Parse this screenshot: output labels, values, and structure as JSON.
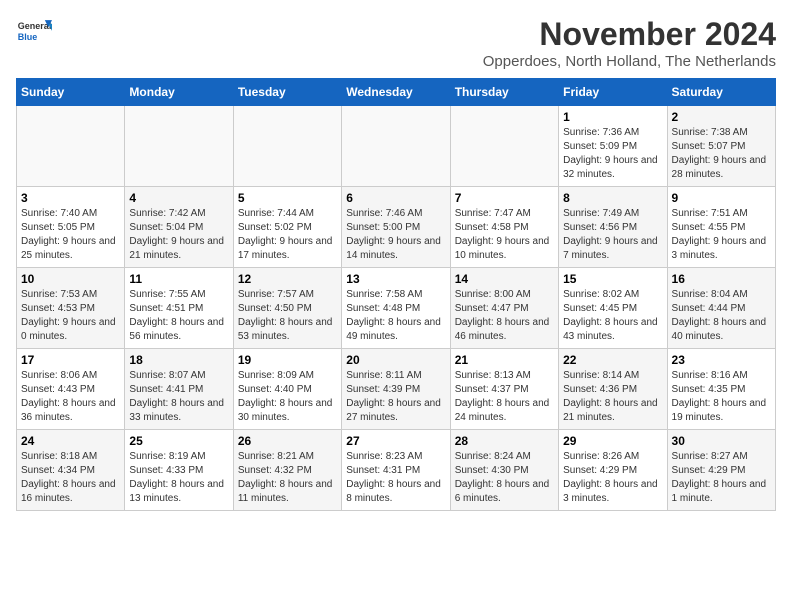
{
  "logo": {
    "general": "General",
    "blue": "Blue"
  },
  "header": {
    "month_title": "November 2024",
    "subtitle": "Opperdoes, North Holland, The Netherlands"
  },
  "weekdays": [
    "Sunday",
    "Monday",
    "Tuesday",
    "Wednesday",
    "Thursday",
    "Friday",
    "Saturday"
  ],
  "weeks": [
    [
      {
        "day": "",
        "info": "",
        "empty": true
      },
      {
        "day": "",
        "info": "",
        "empty": true
      },
      {
        "day": "",
        "info": "",
        "empty": true
      },
      {
        "day": "",
        "info": "",
        "empty": true
      },
      {
        "day": "",
        "info": "",
        "empty": true
      },
      {
        "day": "1",
        "info": "Sunrise: 7:36 AM\nSunset: 5:09 PM\nDaylight: 9 hours and 32 minutes.",
        "empty": false,
        "shaded": false
      },
      {
        "day": "2",
        "info": "Sunrise: 7:38 AM\nSunset: 5:07 PM\nDaylight: 9 hours and 28 minutes.",
        "empty": false,
        "shaded": true
      }
    ],
    [
      {
        "day": "3",
        "info": "Sunrise: 7:40 AM\nSunset: 5:05 PM\nDaylight: 9 hours and 25 minutes.",
        "empty": false,
        "shaded": false
      },
      {
        "day": "4",
        "info": "Sunrise: 7:42 AM\nSunset: 5:04 PM\nDaylight: 9 hours and 21 minutes.",
        "empty": false,
        "shaded": true
      },
      {
        "day": "5",
        "info": "Sunrise: 7:44 AM\nSunset: 5:02 PM\nDaylight: 9 hours and 17 minutes.",
        "empty": false,
        "shaded": false
      },
      {
        "day": "6",
        "info": "Sunrise: 7:46 AM\nSunset: 5:00 PM\nDaylight: 9 hours and 14 minutes.",
        "empty": false,
        "shaded": true
      },
      {
        "day": "7",
        "info": "Sunrise: 7:47 AM\nSunset: 4:58 PM\nDaylight: 9 hours and 10 minutes.",
        "empty": false,
        "shaded": false
      },
      {
        "day": "8",
        "info": "Sunrise: 7:49 AM\nSunset: 4:56 PM\nDaylight: 9 hours and 7 minutes.",
        "empty": false,
        "shaded": true
      },
      {
        "day": "9",
        "info": "Sunrise: 7:51 AM\nSunset: 4:55 PM\nDaylight: 9 hours and 3 minutes.",
        "empty": false,
        "shaded": false
      }
    ],
    [
      {
        "day": "10",
        "info": "Sunrise: 7:53 AM\nSunset: 4:53 PM\nDaylight: 9 hours and 0 minutes.",
        "empty": false,
        "shaded": true
      },
      {
        "day": "11",
        "info": "Sunrise: 7:55 AM\nSunset: 4:51 PM\nDaylight: 8 hours and 56 minutes.",
        "empty": false,
        "shaded": false
      },
      {
        "day": "12",
        "info": "Sunrise: 7:57 AM\nSunset: 4:50 PM\nDaylight: 8 hours and 53 minutes.",
        "empty": false,
        "shaded": true
      },
      {
        "day": "13",
        "info": "Sunrise: 7:58 AM\nSunset: 4:48 PM\nDaylight: 8 hours and 49 minutes.",
        "empty": false,
        "shaded": false
      },
      {
        "day": "14",
        "info": "Sunrise: 8:00 AM\nSunset: 4:47 PM\nDaylight: 8 hours and 46 minutes.",
        "empty": false,
        "shaded": true
      },
      {
        "day": "15",
        "info": "Sunrise: 8:02 AM\nSunset: 4:45 PM\nDaylight: 8 hours and 43 minutes.",
        "empty": false,
        "shaded": false
      },
      {
        "day": "16",
        "info": "Sunrise: 8:04 AM\nSunset: 4:44 PM\nDaylight: 8 hours and 40 minutes.",
        "empty": false,
        "shaded": true
      }
    ],
    [
      {
        "day": "17",
        "info": "Sunrise: 8:06 AM\nSunset: 4:43 PM\nDaylight: 8 hours and 36 minutes.",
        "empty": false,
        "shaded": false
      },
      {
        "day": "18",
        "info": "Sunrise: 8:07 AM\nSunset: 4:41 PM\nDaylight: 8 hours and 33 minutes.",
        "empty": false,
        "shaded": true
      },
      {
        "day": "19",
        "info": "Sunrise: 8:09 AM\nSunset: 4:40 PM\nDaylight: 8 hours and 30 minutes.",
        "empty": false,
        "shaded": false
      },
      {
        "day": "20",
        "info": "Sunrise: 8:11 AM\nSunset: 4:39 PM\nDaylight: 8 hours and 27 minutes.",
        "empty": false,
        "shaded": true
      },
      {
        "day": "21",
        "info": "Sunrise: 8:13 AM\nSunset: 4:37 PM\nDaylight: 8 hours and 24 minutes.",
        "empty": false,
        "shaded": false
      },
      {
        "day": "22",
        "info": "Sunrise: 8:14 AM\nSunset: 4:36 PM\nDaylight: 8 hours and 21 minutes.",
        "empty": false,
        "shaded": true
      },
      {
        "day": "23",
        "info": "Sunrise: 8:16 AM\nSunset: 4:35 PM\nDaylight: 8 hours and 19 minutes.",
        "empty": false,
        "shaded": false
      }
    ],
    [
      {
        "day": "24",
        "info": "Sunrise: 8:18 AM\nSunset: 4:34 PM\nDaylight: 8 hours and 16 minutes.",
        "empty": false,
        "shaded": true
      },
      {
        "day": "25",
        "info": "Sunrise: 8:19 AM\nSunset: 4:33 PM\nDaylight: 8 hours and 13 minutes.",
        "empty": false,
        "shaded": false
      },
      {
        "day": "26",
        "info": "Sunrise: 8:21 AM\nSunset: 4:32 PM\nDaylight: 8 hours and 11 minutes.",
        "empty": false,
        "shaded": true
      },
      {
        "day": "27",
        "info": "Sunrise: 8:23 AM\nSunset: 4:31 PM\nDaylight: 8 hours and 8 minutes.",
        "empty": false,
        "shaded": false
      },
      {
        "day": "28",
        "info": "Sunrise: 8:24 AM\nSunset: 4:30 PM\nDaylight: 8 hours and 6 minutes.",
        "empty": false,
        "shaded": true
      },
      {
        "day": "29",
        "info": "Sunrise: 8:26 AM\nSunset: 4:29 PM\nDaylight: 8 hours and 3 minutes.",
        "empty": false,
        "shaded": false
      },
      {
        "day": "30",
        "info": "Sunrise: 8:27 AM\nSunset: 4:29 PM\nDaylight: 8 hours and 1 minute.",
        "empty": false,
        "shaded": true
      }
    ]
  ]
}
